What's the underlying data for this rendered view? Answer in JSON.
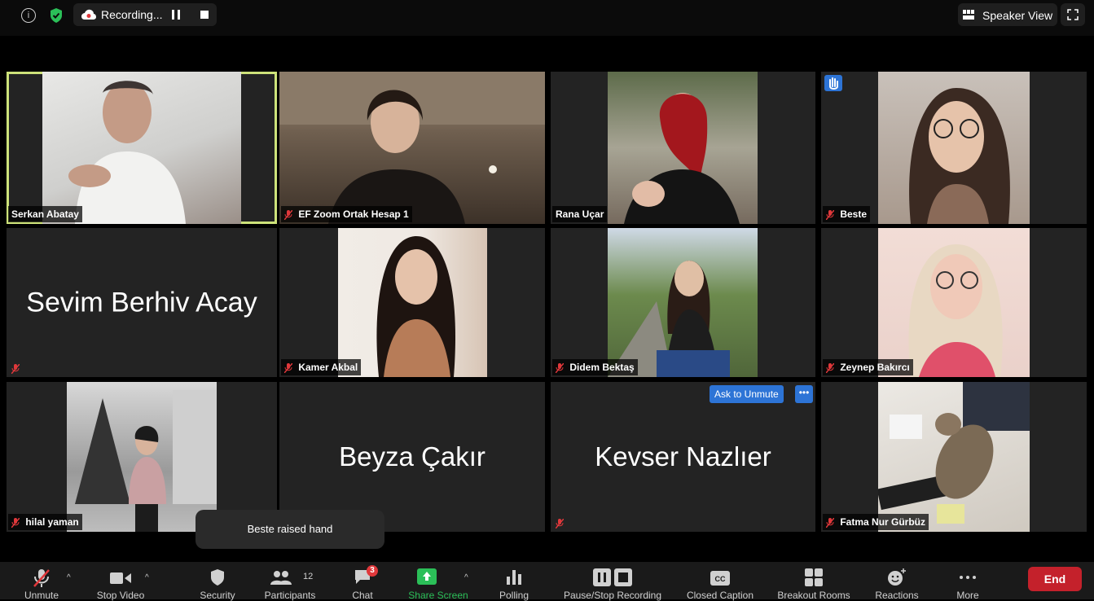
{
  "topbar": {
    "recording_label": "Recording...",
    "speaker_view_label": "Speaker View"
  },
  "tiles": [
    {
      "name": "Serkan Abatay",
      "muted": false,
      "active": true
    },
    {
      "name": "EF Zoom Ortak Hesap 1",
      "muted": true
    },
    {
      "name": "Rana Uçar",
      "muted": false
    },
    {
      "name": "Beste",
      "muted": true,
      "hand_raised": true
    },
    {
      "name": "Sevim Berhiv Acay",
      "muted": true,
      "video_off": true
    },
    {
      "name": "Kamer Akbal",
      "muted": true
    },
    {
      "name": "Didem Bektaş",
      "muted": true
    },
    {
      "name": "Zeynep Bakırcı",
      "muted": true
    },
    {
      "name": "hilal yaman",
      "muted": true
    },
    {
      "name": "Beyza Çakır",
      "muted": false,
      "video_off": true
    },
    {
      "name": "Kevser Nazlıer",
      "muted": true,
      "video_off": true
    },
    {
      "name": "Fatma Nur Gürbüz",
      "muted": true
    }
  ],
  "ask_to_unmute": "Ask to Unmute",
  "more_dots": "•••",
  "toast": "Beste raised hand",
  "toolbar": {
    "unmute": "Unmute",
    "stop_video": "Stop Video",
    "security": "Security",
    "participants": "Participants",
    "participants_count": "12",
    "chat": "Chat",
    "chat_badge": "3",
    "share_screen": "Share Screen",
    "polling": "Polling",
    "pause_stop_recording": "Pause/Stop Recording",
    "closed_caption": "Closed Caption",
    "breakout_rooms": "Breakout Rooms",
    "reactions": "Reactions",
    "more": "More",
    "end": "End"
  },
  "colors": {
    "active_speaker_border": "#cde27a",
    "accent_blue": "#2d74d6",
    "share_green": "#2bbf58",
    "end_red": "#c4212b",
    "muted_red": "#e0383b"
  }
}
